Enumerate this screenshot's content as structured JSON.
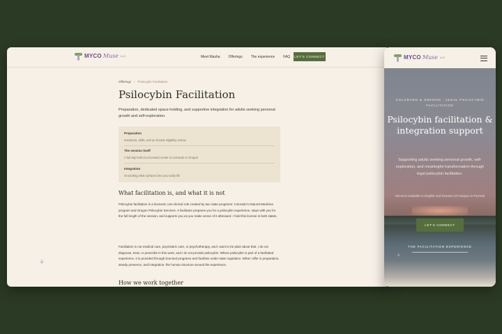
{
  "brand": {
    "mark": "MYCO",
    "script": "Muse",
    "suffix": "LLC"
  },
  "nav": {
    "items": [
      "Meet Masha",
      "Offerings",
      "The experience",
      "FAQ"
    ],
    "cta": "LET'S CONNECT"
  },
  "breadcrumb": {
    "root": "Offerings",
    "separator": "/",
    "current": "Psilocybin Facilitation"
  },
  "page": {
    "title": "Psilocybin Facilitation",
    "lead": "Preparation, dedicated space-holding, and supportive integration for adults seeking personal growth and self-exploration.",
    "card": [
      {
        "title": "Preparation",
        "desc": "Intentions, skills, and an honest eligibility review"
      },
      {
        "title": "The session itself",
        "desc": "A full day held at a licensed center in Colorado or Oregon"
      },
      {
        "title": "Integration",
        "desc": "Grounding what surfaced into your daily life"
      }
    ],
    "section_title": "What facilitation is, and what it is not",
    "paragraph1": "Psilocybin facilitation is a licensed, non-clinical role created by two state programs: Colorado's Natural Medicine program and Oregon Psilocybin Services. A facilitator prepares you for a psilocybin experience, stays with you for the full length of the session, and supports you as you make sense of it afterward. I hold this license in both states.",
    "paragraph2": "Facilitation is not medical care, psychiatric care, or psychotherapy, and I want to be plain about that. I do not diagnose, treat, or prescribe in this work, and I do not provide psilocybin. Where psilocybin is part of a facilitated experience, it is provided through licensed programs and facilities under state regulation. What I offer is preparation, steady presence, and integration: the human structure around the experience.",
    "next_section": "How we work together"
  },
  "mobile": {
    "eyebrow": "COLORADO & OREGON · LEGAL PSILOCYBIN FACILITATION",
    "headline": "Psilocybin facilitation & integration support",
    "subhead": "Supporting adults seeking personal growth, self-exploration, and meaningful transformation through legal psilocybin facilitation.",
    "languages": "Services available in English and Russian (Я говорю по-Русски)",
    "cta": "LET'S CONNECT",
    "link": "THE FACILITATION EXPERIENCE"
  },
  "icons": {
    "menu": "hamburger-icon",
    "decoration": "butterfly-icon"
  },
  "colors": {
    "background": "#2b3a24",
    "cream": "#f6f0e7",
    "accent": "#556e3c",
    "brand": "#6d4c86"
  }
}
